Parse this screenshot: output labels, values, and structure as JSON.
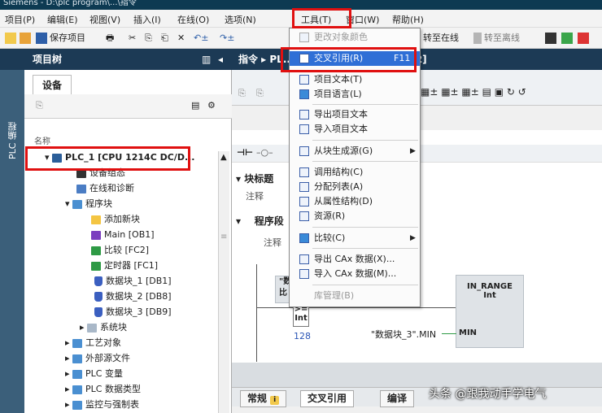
{
  "window": {
    "title": "Siemens - D:\\plc program\\...\\指令"
  },
  "menubar": {
    "items": [
      "项目(P)",
      "编辑(E)",
      "视图(V)",
      "插入(I)",
      "在线(O)",
      "选项(N)",
      "工具(T)",
      "窗口(W)",
      "帮助(H)"
    ]
  },
  "toolbar": {
    "save_label": "保存项目",
    "go_online": "转至在线",
    "go_offline": "转至离线"
  },
  "tree": {
    "header": "项目树",
    "tab": "设备",
    "vertical_label": "PLC 编程",
    "column_name": "名称",
    "rows": [
      {
        "label": "PLC_1 [CPU 1214C DC/D...",
        "icon": "plc-icon"
      },
      {
        "label": "设备组态",
        "icon": "device-config-icon"
      },
      {
        "label": "在线和诊断",
        "icon": "diagnostics-icon"
      },
      {
        "label": "程序块",
        "icon": "folder-icon"
      },
      {
        "label": "添加新块",
        "icon": "add-block-icon"
      },
      {
        "label": "Main [OB1]",
        "icon": "ob-icon"
      },
      {
        "label": "比较 [FC2]",
        "icon": "fc-icon"
      },
      {
        "label": "定时器 [FC1]",
        "icon": "fc-icon"
      },
      {
        "label": "数据块_1 [DB1]",
        "icon": "db-icon"
      },
      {
        "label": "数据块_2 [DB8]",
        "icon": "db-icon"
      },
      {
        "label": "数据块_3 [DB9]",
        "icon": "db-icon"
      },
      {
        "label": "系统块",
        "icon": "folder-icon"
      },
      {
        "label": "工艺对象",
        "icon": "folder-icon"
      },
      {
        "label": "外部源文件",
        "icon": "folder-icon"
      },
      {
        "label": "PLC 变量",
        "icon": "folder-icon"
      },
      {
        "label": "PLC 数据类型",
        "icon": "folder-icon"
      },
      {
        "label": "监控与强制表",
        "icon": "folder-icon"
      }
    ]
  },
  "main": {
    "breadcrumb": "指令 ▸ PL... [DC] ▸ 程序块 ▸ 比较 [FC2]",
    "block_title_label": "块标题",
    "comment1": "注释",
    "network_label": "程序段",
    "comment2": "注释",
    "block_name": "IN_RANGE",
    "block_type": "Int",
    "compare_op": ">=",
    "compare_type": "Int",
    "compare_value": "128",
    "min_operand": "\"数据块_3\".MIN",
    "min_pin": "MIN",
    "data_label_a": "\"数",
    "data_label_b": "比"
  },
  "bottom_tabs": [
    "常规",
    "交叉引用",
    "编译"
  ],
  "tools_menu": {
    "items": [
      {
        "label": "更改对象颜色",
        "disabled": true,
        "icon": "color-icon"
      },
      {
        "label": "交叉引用(R)",
        "shortcut": "F11",
        "highlighted": true,
        "icon": "cross-ref-icon"
      },
      {
        "label": "项目文本(T)",
        "icon": "text-icon"
      },
      {
        "label": "项目语言(L)",
        "icon": "language-icon"
      },
      {
        "label": "导出项目文本",
        "icon": "export-icon"
      },
      {
        "label": "导入项目文本",
        "icon": "import-icon"
      },
      {
        "label": "从块生成源(G)",
        "submenu": true,
        "icon": "generate-icon"
      },
      {
        "label": "调用结构(C)",
        "icon": "call-structure-icon"
      },
      {
        "label": "分配列表(A)",
        "icon": "assignment-icon"
      },
      {
        "label": "从属性结构(D)",
        "icon": "dependency-icon"
      },
      {
        "label": "资源(R)",
        "icon": "resource-icon"
      },
      {
        "label": "比较(C)",
        "submenu": true,
        "icon": "compare-icon"
      },
      {
        "label": "导出 CAx 数据(X)...",
        "icon": "export-cax-icon"
      },
      {
        "label": "导入 CAx 数据(M)...",
        "icon": "import-cax-icon"
      },
      {
        "label": "库管理(B)",
        "disabled": true,
        "icon": "library-icon"
      }
    ]
  },
  "watermark": "头条 @跟我动手学电气",
  "colors": {
    "accent_red": "#e01010",
    "header_dark": "#1c3a55",
    "highlight": "#2f6fd6"
  }
}
